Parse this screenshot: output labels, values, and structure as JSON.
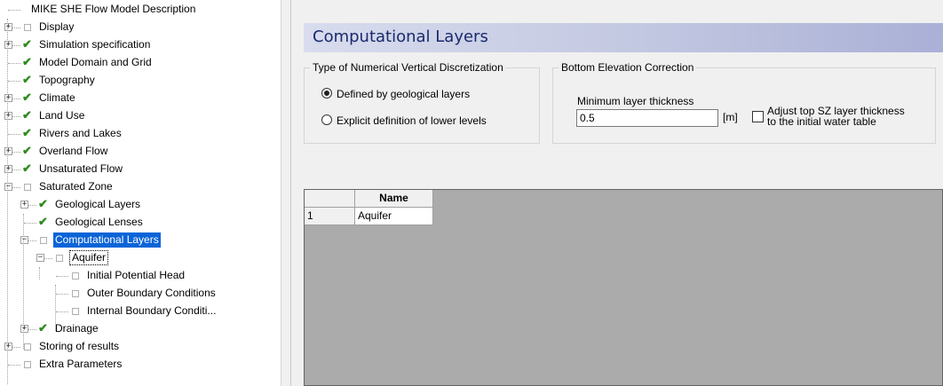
{
  "tree": {
    "items": [
      {
        "label": "MIKE SHE Flow Model Description",
        "level": 0,
        "expander": "",
        "icon": "none"
      },
      {
        "label": "Display",
        "level": 0,
        "expander": "+",
        "icon": "box"
      },
      {
        "label": "Simulation specification",
        "level": 0,
        "expander": "+",
        "icon": "check"
      },
      {
        "label": "Model Domain and Grid",
        "level": 0,
        "expander": "",
        "icon": "check"
      },
      {
        "label": "Topography",
        "level": 0,
        "expander": "",
        "icon": "check"
      },
      {
        "label": "Climate",
        "level": 0,
        "expander": "+",
        "icon": "check"
      },
      {
        "label": "Land Use",
        "level": 0,
        "expander": "+",
        "icon": "check"
      },
      {
        "label": "Rivers and Lakes",
        "level": 0,
        "expander": "",
        "icon": "check"
      },
      {
        "label": "Overland Flow",
        "level": 0,
        "expander": "+",
        "icon": "check"
      },
      {
        "label": "Unsaturated Flow",
        "level": 0,
        "expander": "+",
        "icon": "check"
      },
      {
        "label": "Saturated Zone",
        "level": 0,
        "expander": "-",
        "icon": "box"
      },
      {
        "label": "Geological Layers",
        "level": 1,
        "expander": "+",
        "icon": "check"
      },
      {
        "label": "Geological Lenses",
        "level": 1,
        "expander": "",
        "icon": "check"
      },
      {
        "label": "Computational Layers",
        "level": 1,
        "expander": "-",
        "icon": "box",
        "selected": true
      },
      {
        "label": "Aquifer",
        "level": 2,
        "expander": "-",
        "icon": "box",
        "focused": true
      },
      {
        "label": "Initial Potential Head",
        "level": 3,
        "expander": "",
        "icon": "box"
      },
      {
        "label": "Outer Boundary Conditions",
        "level": 3,
        "expander": "",
        "icon": "box"
      },
      {
        "label": "Internal Boundary Conditi...",
        "level": 3,
        "expander": "",
        "icon": "box"
      },
      {
        "label": "Drainage",
        "level": 1,
        "expander": "+",
        "icon": "check"
      },
      {
        "label": "Storing of results",
        "level": 0,
        "expander": "+",
        "icon": "box"
      },
      {
        "label": "Extra Parameters",
        "level": 0,
        "expander": "",
        "icon": "box"
      }
    ]
  },
  "panel": {
    "title": "Computational Layers",
    "discretization": {
      "title": "Type of Numerical Vertical Discretization",
      "option_geological": "Defined by geological layers",
      "option_explicit": "Explicit definition of lower levels",
      "selected": "geological"
    },
    "bottom_correction": {
      "title": "Bottom Elevation Correction",
      "min_thickness_label": "Minimum layer thickness",
      "min_thickness_value": "0.5",
      "unit": "[m]",
      "adjust_label_line1": "Adjust top SZ layer thickness",
      "adjust_label_line2": "to the initial water table",
      "adjust_checked": false
    },
    "grid": {
      "header_name": "Name",
      "rows": [
        {
          "index": "1",
          "name": "Aquifer"
        }
      ]
    }
  },
  "colors": {
    "selection": "#0a64d7",
    "check": "#2e8b1e",
    "header_text": "#1a2a6c",
    "panel_bg": "#f0f0f0",
    "grid_bg": "#ababab"
  }
}
